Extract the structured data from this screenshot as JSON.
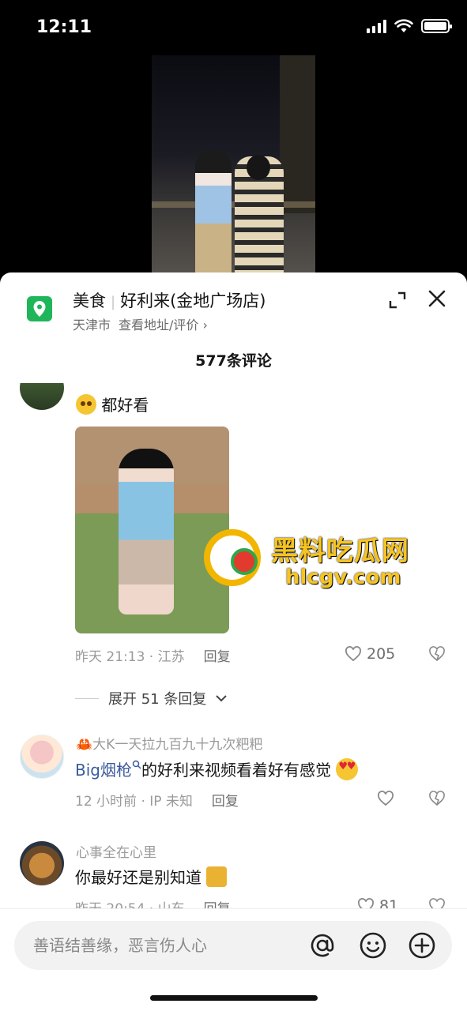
{
  "status_bar": {
    "time": "12:11"
  },
  "poi": {
    "category": "美食",
    "name": "好利来(金地广场店)",
    "city": "天津市",
    "link": "查看地址/评价 ›"
  },
  "comments_header": {
    "count_label": "577条评论"
  },
  "comments": [
    {
      "text": "都好看",
      "time_location": "昨天 21:13 · 江苏",
      "reply_label": "回复",
      "likes": "205",
      "expand_label": "展开 51 条回复"
    },
    {
      "username": "大K一天拉九百九十九次粑粑",
      "mention": "Big烟枪",
      "text": "的好利来视频看着好有感觉",
      "time_location": "12 小时前 · IP 未知",
      "reply_label": "回复"
    },
    {
      "username": "心事全在心里",
      "text": "你最好还是别知道",
      "time_location": "昨天 20:54 · 山东",
      "reply_label": "回复",
      "likes": "81"
    }
  ],
  "watermark": {
    "title": "黑料吃瓜网",
    "url": "hlcgv.com"
  },
  "input": {
    "placeholder": "善语结善缘，恶言伤人心"
  },
  "colors": {
    "pin": "#1fb65a",
    "mention": "#3a5a9e",
    "watermark": "#f6c420"
  }
}
